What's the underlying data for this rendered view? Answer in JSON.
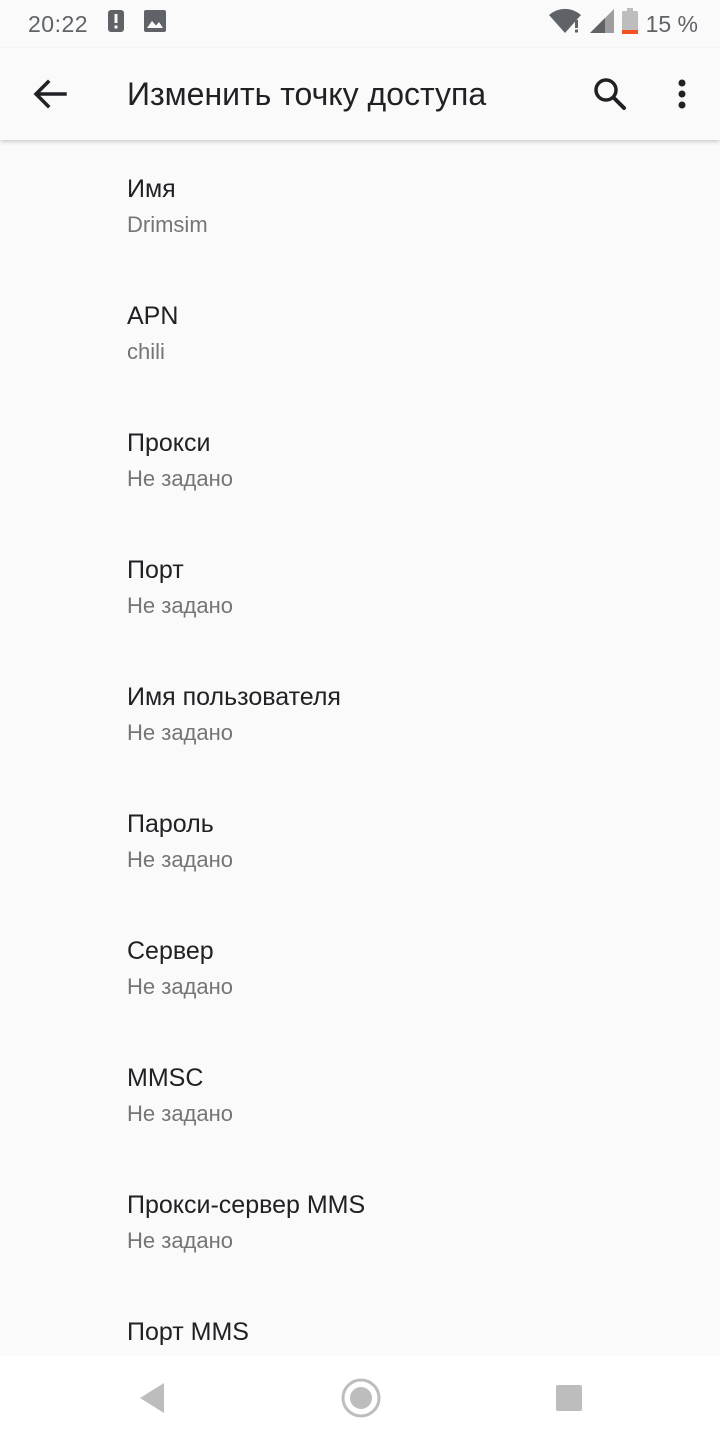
{
  "status_bar": {
    "time": "20:22",
    "battery_percent": "15 %",
    "battery_level": 0.15,
    "icons": [
      "alert-icon",
      "image-icon",
      "wifi-icon",
      "signal-icon",
      "battery-icon"
    ]
  },
  "app_bar": {
    "title": "Изменить точку доступа",
    "icons": [
      "back-arrow-icon",
      "search-icon",
      "more-vert-icon"
    ]
  },
  "settings": {
    "items": [
      {
        "title": "Имя",
        "summary": "Drimsim"
      },
      {
        "title": "APN",
        "summary": "chili"
      },
      {
        "title": "Прокси",
        "summary": "Не задано"
      },
      {
        "title": "Порт",
        "summary": "Не задано"
      },
      {
        "title": "Имя пользователя",
        "summary": "Не задано"
      },
      {
        "title": "Пароль",
        "summary": "Не задано"
      },
      {
        "title": "Сервер",
        "summary": "Не задано"
      },
      {
        "title": "MMSC",
        "summary": "Не задано"
      },
      {
        "title": "Прокси-сервер MMS",
        "summary": "Не задано"
      },
      {
        "title": "Порт MMS"
      }
    ]
  },
  "nav_bar": {
    "icons": [
      "nav-back-icon",
      "nav-home-icon",
      "nav-recents-icon"
    ]
  },
  "colors": {
    "background": "#fafafa",
    "text_primary": "#202124",
    "text_secondary": "#757575",
    "status_icon": "#5f6368",
    "battery_low": "#f4511e",
    "nav_icon": "#bdbdbd"
  }
}
